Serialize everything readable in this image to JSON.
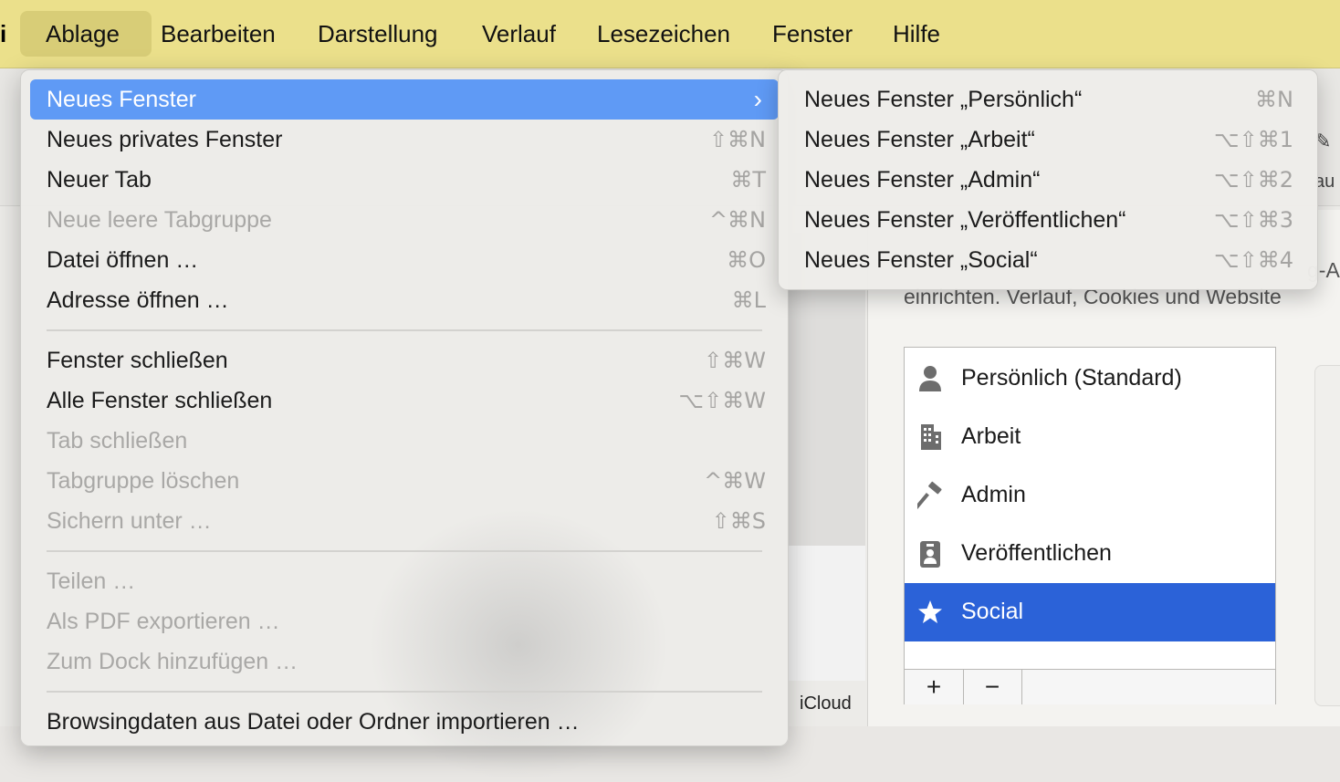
{
  "menubar": {
    "app_glyph": "i",
    "items": [
      "Ablage",
      "Bearbeiten",
      "Darstellung",
      "Verlauf",
      "Lesezeichen",
      "Fenster",
      "Hilfe"
    ],
    "active": "Ablage"
  },
  "file_menu": {
    "items": [
      {
        "label": "Neues Fenster",
        "shortcut": "",
        "state": "highlighted",
        "submenu": true
      },
      {
        "label": "Neues privates Fenster",
        "shortcut": "⇧⌘N",
        "state": "enabled"
      },
      {
        "label": "Neuer Tab",
        "shortcut": "⌘T",
        "state": "enabled"
      },
      {
        "label": "Neue leere Tabgruppe",
        "shortcut": "^⌘N",
        "state": "disabled"
      },
      {
        "label": "Datei öffnen …",
        "shortcut": "⌘O",
        "state": "enabled"
      },
      {
        "label": "Adresse öffnen …",
        "shortcut": "⌘L",
        "state": "enabled"
      },
      {
        "label": "Fenster schließen",
        "shortcut": "⇧⌘W",
        "state": "enabled"
      },
      {
        "label": "Alle Fenster schließen",
        "shortcut": "⌥⇧⌘W",
        "state": "enabled"
      },
      {
        "label": "Tab schließen",
        "shortcut": "",
        "state": "disabled"
      },
      {
        "label": "Tabgruppe löschen",
        "shortcut": "^⌘W",
        "state": "disabled"
      },
      {
        "label": "Sichern unter …",
        "shortcut": "⇧⌘S",
        "state": "disabled"
      },
      {
        "label": "Teilen …",
        "shortcut": "",
        "state": "disabled"
      },
      {
        "label": "Als PDF exportieren …",
        "shortcut": "",
        "state": "disabled"
      },
      {
        "label": "Zum Dock hinzufügen …",
        "shortcut": "",
        "state": "disabled"
      },
      {
        "label": "Browsingdaten aus Datei oder Ordner importieren …",
        "shortcut": "",
        "state": "enabled"
      }
    ]
  },
  "new_window_submenu": {
    "items": [
      {
        "label": "Neues Fenster „Persönlich“",
        "shortcut": "⌘N"
      },
      {
        "label": "Neues Fenster „Arbeit“",
        "shortcut": "⌥⇧⌘1"
      },
      {
        "label": "Neues Fenster „Admin“",
        "shortcut": "⌥⇧⌘2"
      },
      {
        "label": "Neues Fenster „Veröffentlichen“",
        "shortcut": "⌥⇧⌘3"
      },
      {
        "label": "Neues Fenster „Social“",
        "shortcut": "⌥⇧⌘4"
      }
    ]
  },
  "background": {
    "pref_text_line1_tail": "g-A",
    "pref_text_line2": "einrichten. Verlauf, Cookies und Website",
    "toolbar_fragment": "au",
    "sidebar_label": "iCloud",
    "profiles": [
      {
        "label": "Persönlich (Standard)",
        "icon": "person-icon",
        "selected": false
      },
      {
        "label": "Arbeit",
        "icon": "building-icon",
        "selected": false
      },
      {
        "label": "Admin",
        "icon": "hammer-icon",
        "selected": false
      },
      {
        "label": "Veröffentlichen",
        "icon": "badge-icon",
        "selected": false
      },
      {
        "label": "Social",
        "icon": "star-icon",
        "selected": true
      }
    ],
    "add_label": "+",
    "remove_label": "−"
  },
  "colors": {
    "menubar": "#ebe08b",
    "highlight": "#5f9af5",
    "selection": "#2b62d8"
  }
}
